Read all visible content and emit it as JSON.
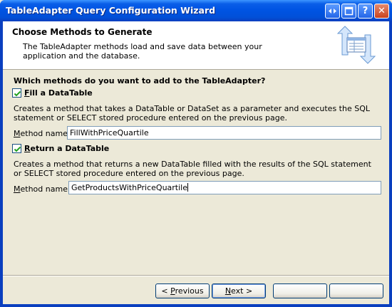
{
  "window": {
    "title": "TableAdapter Query Configuration Wizard",
    "buttons": {
      "help": "?",
      "close": "✕"
    }
  },
  "header": {
    "title": "Choose Methods to Generate",
    "description": "The TableAdapter methods load and save data between your application and the database."
  },
  "question": "Which methods do you want to add to the TableAdapter?",
  "fill": {
    "checked": true,
    "label_accel": "F",
    "label_rest": "ill a DataTable",
    "description": "Creates a method that takes a DataTable or DataSet as a parameter and executes the SQL statement or SELECT stored procedure entered on the previous page.",
    "method_label_accel": "M",
    "method_label_rest": "ethod name:",
    "method_value": "FillWithPriceQuartile"
  },
  "return": {
    "checked": true,
    "label_accel": "R",
    "label_rest": "eturn a DataTable",
    "description": "Creates a method that returns a new DataTable filled with the results of the SQL statement or SELECT stored procedure entered on the previous page.",
    "method_label_accel": "M",
    "method_label_rest": "ethod name:",
    "method_value": "GetProductsWithPriceQuartile"
  },
  "buttons": {
    "previous_open": "< ",
    "previous_accel": "P",
    "previous_rest": "revious",
    "next_accel": "N",
    "next_rest": "ext >"
  },
  "colors": {
    "titlebar": "#0054e3",
    "frame": "#0a3fbf",
    "dialog_bg": "#ece9d8",
    "check_green": "#21a121"
  },
  "icons": [
    "maximize-icon",
    "help-icon",
    "close-icon",
    "wizard-art-icon",
    "checkmark-icon"
  ]
}
